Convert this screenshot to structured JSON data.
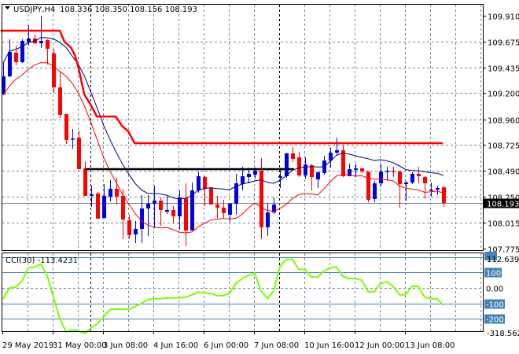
{
  "header": {
    "symbol": "USDJPY,H4",
    "ohlc": "108.336 108.350 108.156 108.193"
  },
  "colors": {
    "bull": "#0000e0",
    "bear": "#ff0000",
    "ma_upper": "#000080",
    "ma_lower": "#ff0000",
    "step_line": "#ff0000",
    "cci": "#7cfc00",
    "levels": "#4682b4",
    "grid": "#778899"
  },
  "chart_data": [
    {
      "type": "candlestick",
      "title": "USDJPY,H4",
      "ylim": [
        107.775,
        109.91
      ],
      "y_ticks": [
        "109.910",
        "109.675",
        "109.435",
        "109.200",
        "108.960",
        "108.725",
        "108.490",
        "108.250",
        "108.015",
        "107.775"
      ],
      "current_price": "108.193",
      "x_labels": [
        {
          "label": "29 May 2019",
          "bar": 0
        },
        {
          "label": "31 May 00:00",
          "bar": 8
        },
        {
          "label": "3 Jun 08:00",
          "bar": 16
        },
        {
          "label": "4 Jun 16:00",
          "bar": 24
        },
        {
          "label": "6 Jun 00:00",
          "bar": 32
        },
        {
          "label": "7 Jun 08:00",
          "bar": 40
        },
        {
          "label": "10 Jun 16:00",
          "bar": 48
        },
        {
          "label": "12 Jun 00:00",
          "bar": 56
        },
        {
          "label": "13 Jun 08:00",
          "bar": 64
        }
      ],
      "ohlc": [
        [
          109.189,
          109.477,
          109.181,
          109.354
        ],
        [
          109.354,
          109.694,
          109.347,
          109.578
        ],
        [
          109.571,
          109.636,
          109.455,
          109.484
        ],
        [
          109.484,
          109.694,
          109.477,
          109.679
        ],
        [
          109.672,
          109.823,
          109.636,
          109.701
        ],
        [
          109.701,
          109.737,
          109.65,
          109.657
        ],
        [
          109.657,
          109.91,
          109.614,
          109.679
        ],
        [
          109.686,
          109.694,
          109.463,
          109.607
        ],
        [
          109.564,
          109.607,
          109.203,
          109.253
        ],
        [
          109.253,
          109.39,
          108.972,
          109.001
        ],
        [
          109.008,
          109.008,
          108.734,
          108.77
        ],
        [
          108.777,
          108.871,
          108.691,
          108.784
        ],
        [
          108.792,
          108.857,
          108.503,
          108.503
        ],
        [
          108.51,
          108.575,
          108.258,
          108.258
        ],
        [
          108.258,
          108.352,
          108.157,
          108.272
        ],
        [
          108.279,
          108.294,
          108.049,
          108.049
        ],
        [
          108.056,
          108.366,
          108.049,
          108.258
        ],
        [
          108.251,
          108.402,
          108.207,
          108.323
        ],
        [
          108.323,
          108.424,
          108.178,
          108.251
        ],
        [
          108.258,
          108.323,
          107.861,
          108.041
        ],
        [
          108.034,
          108.085,
          107.861,
          107.897
        ],
        [
          107.904,
          108.027,
          107.825,
          107.955
        ],
        [
          107.955,
          108.265,
          107.825,
          108.142
        ],
        [
          108.142,
          108.265,
          107.89,
          108.186
        ],
        [
          108.186,
          108.352,
          107.962,
          108.214
        ],
        [
          108.214,
          108.243,
          107.984,
          108.128
        ],
        [
          108.113,
          108.258,
          108.092,
          108.128
        ],
        [
          108.128,
          108.164,
          108.005,
          108.07
        ],
        [
          108.07,
          108.308,
          107.948,
          108.243
        ],
        [
          108.236,
          108.373,
          107.796,
          107.94
        ],
        [
          107.94,
          108.38,
          107.94,
          108.308
        ],
        [
          108.308,
          108.481,
          108.287,
          108.438
        ],
        [
          108.431,
          108.438,
          108.164,
          108.323
        ],
        [
          108.33,
          108.33,
          108.178,
          108.178
        ],
        [
          108.178,
          108.258,
          108.056,
          108.15
        ],
        [
          108.15,
          108.222,
          108.056,
          108.099
        ],
        [
          108.085,
          108.193,
          108.02,
          108.186
        ],
        [
          108.186,
          108.46,
          108.085,
          108.373
        ],
        [
          108.366,
          108.525,
          108.308,
          108.438
        ],
        [
          108.431,
          108.517,
          108.373,
          108.46
        ],
        [
          108.453,
          108.517,
          108.416,
          108.488
        ],
        [
          108.488,
          108.604,
          107.861,
          107.969
        ],
        [
          107.969,
          108.193,
          107.89,
          108.106
        ],
        [
          108.106,
          108.243,
          108.092,
          108.178
        ],
        [
          108.424,
          108.517,
          108.33,
          108.438
        ],
        [
          108.438,
          108.654,
          108.424,
          108.647
        ],
        [
          108.647,
          108.705,
          108.568,
          108.597
        ],
        [
          108.611,
          108.662,
          108.431,
          108.445
        ],
        [
          108.445,
          108.611,
          108.416,
          108.546
        ],
        [
          108.539,
          108.554,
          108.308,
          108.431
        ],
        [
          108.409,
          108.481,
          108.33,
          108.474
        ],
        [
          108.467,
          108.626,
          108.452,
          108.582
        ],
        [
          108.582,
          108.698,
          108.517,
          108.654
        ],
        [
          108.654,
          108.792,
          108.633,
          108.676
        ],
        [
          108.676,
          108.727,
          108.431,
          108.438
        ],
        [
          108.438,
          108.554,
          108.438,
          108.503
        ],
        [
          108.496,
          108.554,
          108.431,
          108.51
        ],
        [
          108.51,
          108.517,
          108.467,
          108.481
        ],
        [
          108.481,
          108.481,
          108.2,
          108.222
        ],
        [
          108.229,
          108.395,
          108.2,
          108.373
        ],
        [
          108.373,
          108.554,
          108.344,
          108.481
        ],
        [
          108.481,
          108.525,
          108.395,
          108.488
        ],
        [
          108.488,
          108.525,
          108.431,
          108.481
        ],
        [
          108.481,
          108.488,
          108.15,
          108.366
        ],
        [
          108.366,
          108.395,
          108.214,
          108.38
        ],
        [
          108.38,
          108.474,
          108.366,
          108.46
        ],
        [
          108.46,
          108.525,
          108.373,
          108.438
        ],
        [
          108.431,
          108.438,
          108.229,
          108.373
        ],
        [
          108.308,
          108.38,
          108.251,
          108.315
        ],
        [
          108.315,
          108.352,
          108.265,
          108.33
        ],
        [
          108.336,
          108.35,
          108.156,
          108.193
        ]
      ],
      "step_line": [
        [
          -0.4,
          109.773
        ],
        [
          9,
          109.773
        ],
        [
          9.75,
          109.672
        ],
        [
          10.75,
          109.621
        ],
        [
          11.4,
          109.549
        ],
        [
          12,
          109.427
        ],
        [
          12.9,
          109.189
        ],
        [
          13.9,
          109.095
        ],
        [
          14.9,
          108.986
        ],
        [
          17.9,
          108.986
        ],
        [
          18.9,
          108.9
        ],
        [
          19.9,
          108.849
        ],
        [
          20.9,
          108.741
        ],
        [
          69.9,
          108.741
        ]
      ],
      "horizontal_line": {
        "price": 108.503,
        "from_bar": 13,
        "to_bar": 46
      }
    },
    {
      "type": "line",
      "title": "CCI(30)",
      "current_value": "-113.4231",
      "label": "CCI(30) -113.4231",
      "y_max_label": "112.639",
      "y_min_label": "-318.5623",
      "levels": [
        {
          "value": 100,
          "label": "100"
        },
        {
          "value": 0,
          "label": "0.00"
        },
        {
          "value": -100,
          "label": "-100"
        },
        {
          "value": -200,
          "label": "-200"
        }
      ],
      "values": [
        -70,
        0,
        5,
        45,
        130,
        135,
        155,
        80,
        -60,
        -200,
        -285,
        -270,
        -280,
        -295,
        -258,
        -232,
        -185,
        -140,
        -138,
        -138,
        -137,
        -120,
        -100,
        -76,
        -70,
        -70,
        -65,
        -65,
        -64,
        -60,
        -45,
        -27,
        -31,
        -36,
        -50,
        -50,
        -35,
        30,
        60,
        82,
        95,
        -20,
        -70,
        -20,
        140,
        185,
        185,
        120,
        120,
        70,
        70,
        110,
        130,
        135,
        75,
        60,
        60,
        50,
        -25,
        -25,
        30,
        40,
        10,
        -45,
        -45,
        10,
        10,
        -60,
        -70,
        -70,
        -113.4
      ]
    }
  ]
}
